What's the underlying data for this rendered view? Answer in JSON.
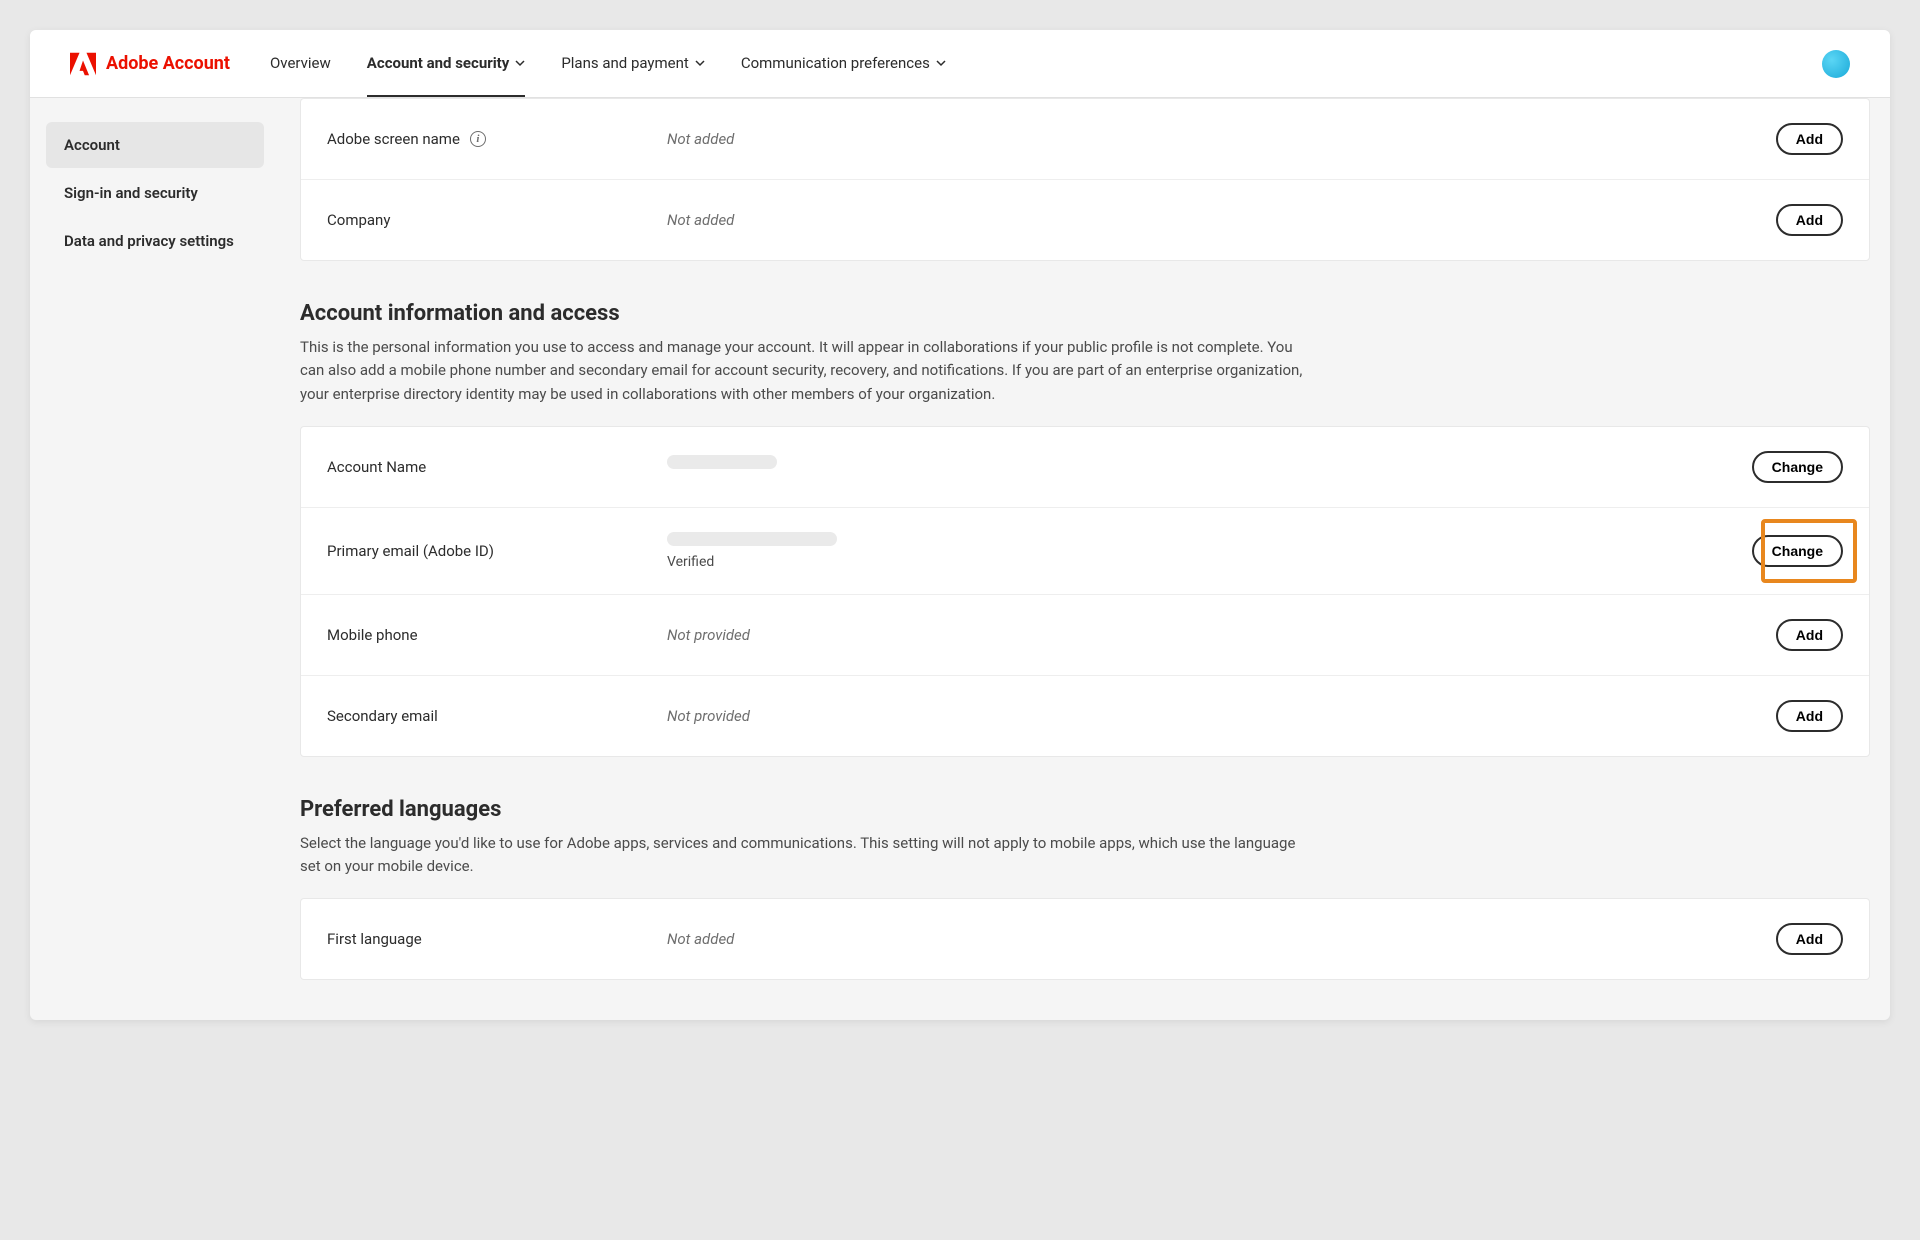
{
  "brand": {
    "name": "Adobe Account"
  },
  "topnav": {
    "overview": "Overview",
    "account_security": "Account and security",
    "plans_payment": "Plans and payment",
    "communication": "Communication preferences"
  },
  "sidebar": {
    "account": "Account",
    "signin": "Sign-in and security",
    "privacy": "Data and privacy settings"
  },
  "profile_rows": {
    "screen_name": {
      "label": "Adobe screen name",
      "value": "Not added",
      "action": "Add"
    },
    "company": {
      "label": "Company",
      "value": "Not added",
      "action": "Add"
    }
  },
  "account_info": {
    "title": "Account information and access",
    "desc": "This is the personal information you use to access and manage your account. It will appear in collaborations if your public profile is not complete. You can also add a mobile phone number and secondary email for account security, recovery, and notifications. If you are part of an enterprise organization, your enterprise directory identity may be used in collaborations with other members of your organization.",
    "rows": {
      "account_name": {
        "label": "Account Name",
        "action": "Change"
      },
      "primary_email": {
        "label": "Primary email (Adobe ID)",
        "status": "Verified",
        "action": "Change"
      },
      "mobile": {
        "label": "Mobile phone",
        "value": "Not provided",
        "action": "Add"
      },
      "secondary": {
        "label": "Secondary email",
        "value": "Not provided",
        "action": "Add"
      }
    }
  },
  "languages": {
    "title": "Preferred languages",
    "desc": "Select the language you'd like to use for Adobe apps, services and communications. This setting will not apply to mobile apps, which use the language set on your mobile device.",
    "rows": {
      "first": {
        "label": "First language",
        "value": "Not added",
        "action": "Add"
      }
    }
  }
}
